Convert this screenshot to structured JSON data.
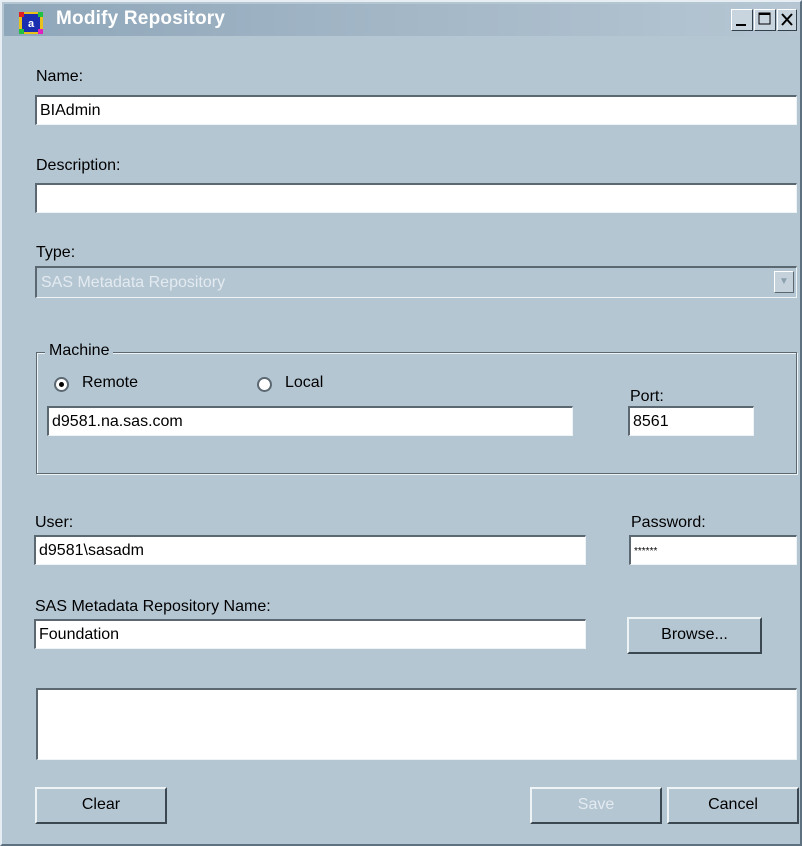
{
  "window": {
    "title": "Modify Repository",
    "controls": {
      "minimize": "_",
      "maximize": "□",
      "close": "×"
    }
  },
  "name": {
    "label": "Name:",
    "value": "BIAdmin"
  },
  "description": {
    "label": "Description:",
    "value": ""
  },
  "type": {
    "label": "Type:",
    "value": "SAS Metadata Repository",
    "dropdown_icon": "chevron-down-icon"
  },
  "machine": {
    "group_label": "Machine",
    "options": [
      {
        "label": "Remote",
        "selected": true
      },
      {
        "label": "Local",
        "selected": false
      }
    ],
    "host": "d9581.na.sas.com",
    "port_label": "Port:",
    "port": "8561"
  },
  "user": {
    "label": "User:",
    "value": "d9581\\sasadm"
  },
  "password": {
    "label": "Password:",
    "value": "******"
  },
  "repository": {
    "label": "SAS Metadata Repository Name:",
    "value": "Foundation",
    "browse_label": "Browse..."
  },
  "messages": {
    "value": ""
  },
  "buttons": {
    "clear": "Clear",
    "save": "Save",
    "cancel": "Cancel"
  }
}
